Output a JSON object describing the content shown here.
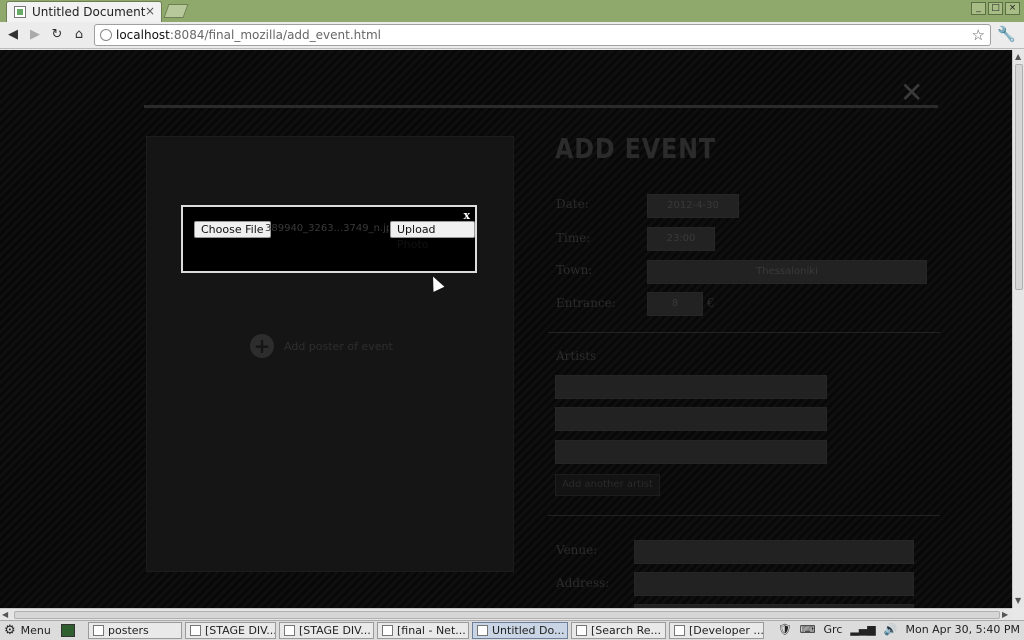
{
  "browser": {
    "tab_title": "Untitled Document",
    "tab_close": "×",
    "url_host": "localhost",
    "url_rest": ":8084/final_mozilla/add_event.html",
    "window_controls": [
      "_",
      "□",
      "×"
    ]
  },
  "page": {
    "close_glyph": "✕",
    "form_title": "ADD EVENT",
    "poster_add_label": "Add poster of event",
    "fields": {
      "date_label": "Date:",
      "date_value": "2012-4-30",
      "time_label": "Time:",
      "time_value": "23:00",
      "town_label": "Town:",
      "town_value": "Thessaloniki",
      "entrance_label": "Entrance:",
      "entrance_value": "8",
      "entrance_unit": "€"
    },
    "artists_label": "Artists",
    "add_artist_label": "Add another artist",
    "venue_label": "Venue:",
    "address_label": "Address:"
  },
  "modal": {
    "close_label": "x",
    "choose_file_label": "Choose File",
    "file_name": "389940_3263...3749_n.jpg",
    "upload_label": "Upload Photo"
  },
  "taskbar": {
    "menu_label": "Menu",
    "items": [
      {
        "label": "posters",
        "width": 94
      },
      {
        "label": "[STAGE DIV...",
        "width": 91
      },
      {
        "label": "[STAGE DIV...",
        "width": 95
      },
      {
        "label": "[final - Net...",
        "width": 92
      },
      {
        "label": "Untitled Do...",
        "width": 96,
        "active": true
      },
      {
        "label": "[Search Re...",
        "width": 95
      },
      {
        "label": "[Developer ...",
        "width": 95
      }
    ],
    "tray_weather": "Grc",
    "clock": "Mon Apr 30,  5:40 PM"
  }
}
